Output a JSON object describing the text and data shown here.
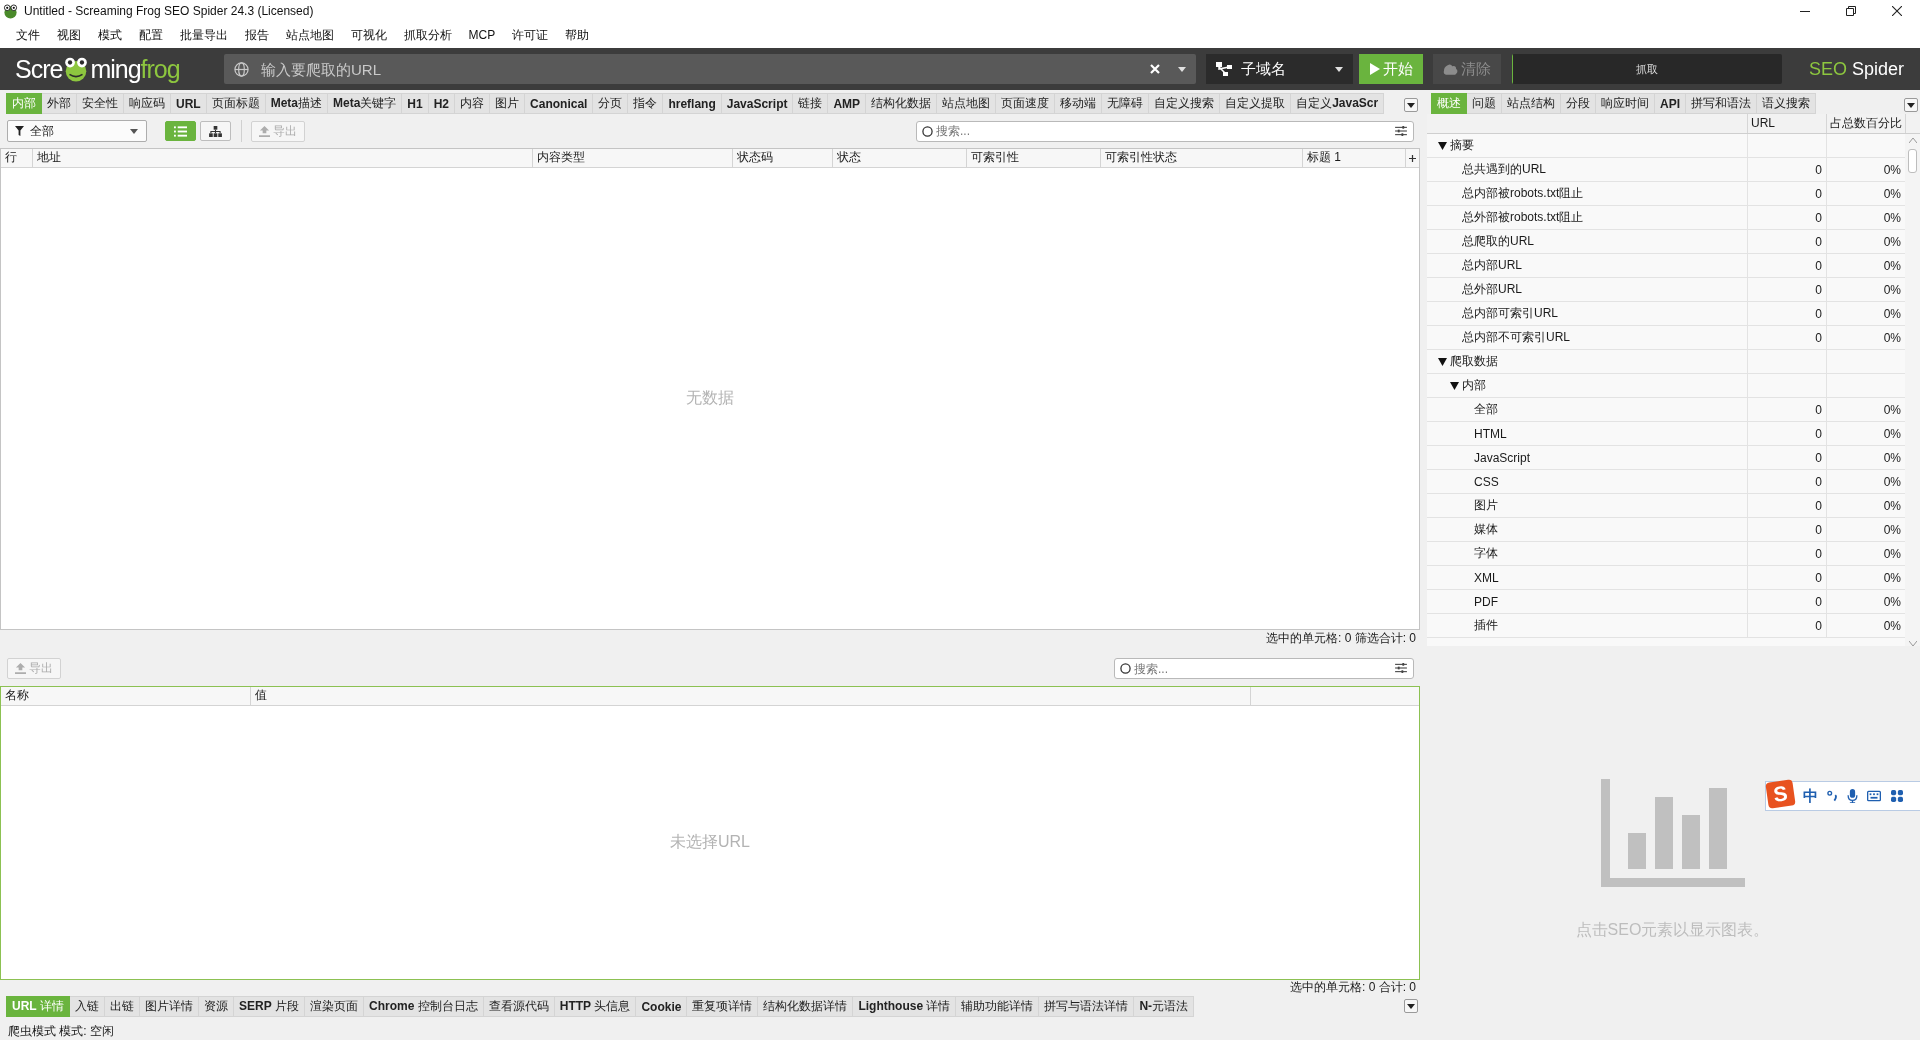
{
  "window": {
    "title": "Untitled - Screaming Frog SEO Spider 24.3 (Licensed)"
  },
  "menu": [
    "文件",
    "视图",
    "模式",
    "配置",
    "批量导出",
    "报告",
    "站点地图",
    "可视化",
    "抓取分析",
    "MCP",
    "许可证",
    "帮助"
  ],
  "toolbar": {
    "logo": {
      "lead": "Scre",
      "tail": "ming",
      "accent": "frog"
    },
    "url_field": {
      "placeholder": "输入要爬取的URL"
    },
    "mode": {
      "label": "子域名"
    },
    "start": {
      "label": "开始",
      "disabled": false
    },
    "clear": {
      "label": "清除",
      "disabled": true
    },
    "progress": {
      "label": "抓取",
      "level": 0
    },
    "brand": {
      "accent": "SEO",
      "text": "Spider"
    }
  },
  "main": {
    "tabs": [
      {
        "label": "内部",
        "selected": true,
        "bold": false
      },
      {
        "label": "外部",
        "selected": false,
        "bold": false
      },
      {
        "label": "安全性",
        "selected": false,
        "bold": false
      },
      {
        "label": "响应码",
        "selected": false,
        "bold": false
      },
      {
        "label": "URL",
        "selected": false,
        "bold": true
      },
      {
        "label": "页面标题",
        "selected": false,
        "bold": false
      },
      {
        "label": "**Meta**描述",
        "selected": false,
        "bold": false
      },
      {
        "label": "**Meta**关键字",
        "selected": false,
        "bold": false
      },
      {
        "label": "H1",
        "selected": false,
        "bold": true
      },
      {
        "label": "H2",
        "selected": false,
        "bold": true
      },
      {
        "label": "内容",
        "selected": false,
        "bold": false
      },
      {
        "label": "图片",
        "selected": false,
        "bold": false
      },
      {
        "label": "Canonical",
        "selected": false,
        "bold": true
      },
      {
        "label": "分页",
        "selected": false,
        "bold": false
      },
      {
        "label": "指令",
        "selected": false,
        "bold": false
      },
      {
        "label": "hreflang",
        "selected": false,
        "bold": true
      },
      {
        "label": "JavaScript",
        "selected": false,
        "bold": true
      },
      {
        "label": "链接",
        "selected": false,
        "bold": false
      },
      {
        "label": "AMP",
        "selected": false,
        "bold": true
      },
      {
        "label": "结构化数据",
        "selected": false,
        "bold": false
      },
      {
        "label": "站点地图",
        "selected": false,
        "bold": false
      },
      {
        "label": "页面速度",
        "selected": false,
        "bold": false
      },
      {
        "label": "移动端",
        "selected": false,
        "bold": false
      },
      {
        "label": "无障碍",
        "selected": false,
        "bold": false
      },
      {
        "label": "自定义搜索",
        "selected": false,
        "bold": false
      },
      {
        "label": "自定义提取",
        "selected": false,
        "bold": false
      },
      {
        "label": "自定义**JavaScr**",
        "selected": false,
        "bold": false
      }
    ],
    "filter": {
      "value": "全部"
    },
    "view_modes": [
      {
        "kind": "list",
        "selected": true
      },
      {
        "kind": "tree",
        "selected": false
      }
    ],
    "export": {
      "label": "导出",
      "disabled": true
    },
    "search": {
      "placeholder": "搜索..."
    },
    "table": {
      "columns": [
        "行",
        "地址",
        "内容类型",
        "状态码",
        "状态",
        "可索引性",
        "可索引性状态",
        "标题 1"
      ],
      "empty_text": "无数据"
    },
    "status": "选中的单元格: 0 筛选合计: 0"
  },
  "details": {
    "export": {
      "label": "导出",
      "disabled": true
    },
    "search": {
      "placeholder": "搜索..."
    },
    "table": {
      "columns": [
        "名称",
        "值"
      ],
      "empty_text": "未选择URL"
    },
    "status": "选中的单元格: 0 合计: 0",
    "tabs": [
      {
        "label": "**URL** 详情",
        "selected": true,
        "bold": false
      },
      {
        "label": "入链",
        "selected": false,
        "bold": false
      },
      {
        "label": "出链",
        "selected": false,
        "bold": false
      },
      {
        "label": "图片详情",
        "selected": false,
        "bold": false
      },
      {
        "label": "资源",
        "selected": false,
        "bold": false
      },
      {
        "label": "**SERP** 片段",
        "selected": false,
        "bold": false
      },
      {
        "label": "渲染页面",
        "selected": false,
        "bold": false
      },
      {
        "label": "**Chrome** 控制台日志",
        "selected": false,
        "bold": false
      },
      {
        "label": "查看源代码",
        "selected": false,
        "bold": false
      },
      {
        "label": "**HTTP** 头信息",
        "selected": false,
        "bold": false
      },
      {
        "label": "Cookie",
        "selected": false,
        "bold": true
      },
      {
        "label": "重复项详情",
        "selected": false,
        "bold": false
      },
      {
        "label": "结构化数据详情",
        "selected": false,
        "bold": false
      },
      {
        "label": "**Lighthouse** 详情",
        "selected": false,
        "bold": false
      },
      {
        "label": "辅助功能详情",
        "selected": false,
        "bold": false
      },
      {
        "label": "拼写与语法详情",
        "selected": false,
        "bold": false
      },
      {
        "label": "**N-**元语法",
        "selected": false,
        "bold": false
      }
    ]
  },
  "overview": {
    "tabs": [
      {
        "label": "概述",
        "selected": true,
        "bold": false
      },
      {
        "label": "问题",
        "selected": false,
        "bold": false
      },
      {
        "label": "站点结构",
        "selected": false,
        "bold": false
      },
      {
        "label": "分段",
        "selected": false,
        "bold": false
      },
      {
        "label": "响应时间",
        "selected": false,
        "bold": false
      },
      {
        "label": "API",
        "selected": false,
        "bold": true
      },
      {
        "label": "拼写和语法",
        "selected": false,
        "bold": false
      },
      {
        "label": "语义搜索",
        "selected": false,
        "bold": false
      }
    ],
    "columns": [
      "URL",
      "占总数百分比"
    ],
    "tree": [
      {
        "label": "摘要",
        "expanded": true,
        "children": [
          {
            "label": "总共遇到的URL",
            "url": "0",
            "percent": "0%"
          },
          {
            "label": "总内部被robots.txt阻止",
            "url": "0",
            "percent": "0%"
          },
          {
            "label": "总外部被robots.txt阻止",
            "url": "0",
            "percent": "0%"
          },
          {
            "label": "总爬取的URL",
            "url": "0",
            "percent": "0%"
          },
          {
            "label": "总内部URL",
            "url": "0",
            "percent": "0%"
          },
          {
            "label": "总外部URL",
            "url": "0",
            "percent": "0%"
          },
          {
            "label": "总内部可索引URL",
            "url": "0",
            "percent": "0%"
          },
          {
            "label": "总内部不可索引URL",
            "url": "0",
            "percent": "0%"
          }
        ]
      },
      {
        "label": "爬取数据",
        "expanded": true,
        "children": [
          {
            "label": "内部",
            "expanded": true,
            "children": [
              {
                "label": "全部",
                "url": "0",
                "percent": "0%"
              },
              {
                "label": "HTML",
                "url": "0",
                "percent": "0%"
              },
              {
                "label": "JavaScript",
                "url": "0",
                "percent": "0%"
              },
              {
                "label": "CSS",
                "url": "0",
                "percent": "0%"
              },
              {
                "label": "图片",
                "url": "0",
                "percent": "0%"
              },
              {
                "label": "媒体",
                "url": "0",
                "percent": "0%"
              },
              {
                "label": "字体",
                "url": "0",
                "percent": "0%"
              },
              {
                "label": "XML",
                "url": "0",
                "percent": "0%"
              },
              {
                "label": "PDF",
                "url": "0",
                "percent": "0%"
              },
              {
                "label": "插件",
                "url": "0",
                "percent": "0%"
              }
            ]
          }
        ]
      }
    ],
    "chart_hint": "点击SEO元素以显示图表。"
  },
  "status_bar": "爬虫模式 模式: 空闲",
  "ime_toolbar": {
    "logo": "S",
    "mode": "中"
  }
}
